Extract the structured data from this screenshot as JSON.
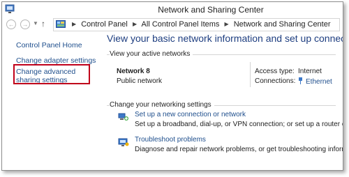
{
  "window": {
    "title": "Network and Sharing Center"
  },
  "address_bar": {
    "crumbs": [
      "Control Panel",
      "All Control Panel Items",
      "Network and Sharing Center"
    ]
  },
  "sidebar": {
    "items": [
      {
        "label": "Control Panel Home"
      },
      {
        "label": "Change adapter settings"
      },
      {
        "label": "Change advanced sharing settings"
      }
    ]
  },
  "main": {
    "heading": "View your basic network information and set up connections",
    "active_networks_label": "View your active networks",
    "network": {
      "name": "Network  8",
      "type": "Public network",
      "access_type_label": "Access type:",
      "access_type_value": "Internet",
      "connections_label": "Connections:",
      "connections_value": "Ethernet"
    },
    "change_settings_label": "Change your networking settings",
    "tasks": [
      {
        "title": "Set up a new connection or network",
        "description": "Set up a broadband, dial-up, or VPN connection; or set up a router or access point.",
        "icon": "network-setup-icon"
      },
      {
        "title": "Troubleshoot problems",
        "description": "Diagnose and repair network problems, or get troubleshooting information.",
        "icon": "troubleshoot-icon"
      }
    ]
  },
  "colors": {
    "link": "#1e4e8c",
    "heading": "#1e3e80",
    "highlight": "#c0001a"
  }
}
